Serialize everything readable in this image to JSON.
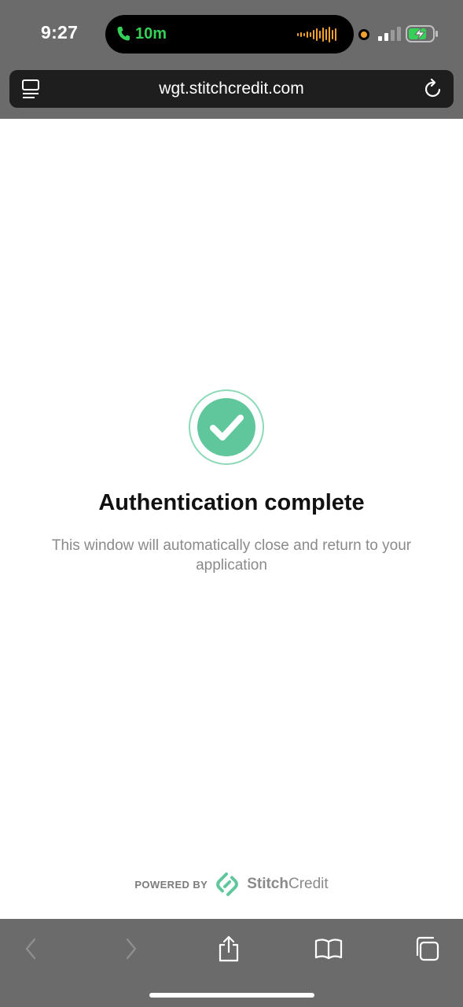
{
  "status_bar": {
    "time": "9:27",
    "call_duration": "10m",
    "call_color": "#34d058",
    "recording_dot_color": "#f2a12f",
    "battery_color": "#34d058"
  },
  "browser": {
    "url": "wgt.stitchcredit.com",
    "reader_icon": "reader-mode-icon",
    "reload_icon": "reload-icon"
  },
  "main": {
    "status_icon": "checkmark-circle-icon",
    "accent_color": "#5fc79b",
    "title": "Authentication complete",
    "subtitle": "This window will automatically close and return to your application"
  },
  "footer": {
    "powered_by": "POWERED BY",
    "brand_bold": "Stitch",
    "brand_regular": "Credit",
    "brand_logo_color": "#5fc79b"
  },
  "toolbar": {
    "items": [
      "back-icon",
      "forward-icon",
      "share-icon",
      "bookmarks-icon",
      "tabs-icon"
    ]
  }
}
